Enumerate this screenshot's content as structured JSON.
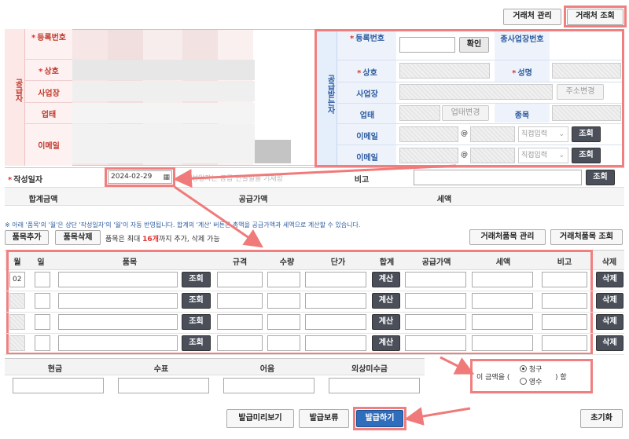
{
  "top_buttons": {
    "client_manage": "거래처 관리",
    "client_search": "거래처 조회"
  },
  "supplier": {
    "side_label": "공급자",
    "fields": [
      "등록번호",
      "상호",
      "사업장",
      "업태",
      "이메일"
    ]
  },
  "receiver": {
    "side_label": "공급받는자",
    "reg_no": "등록번호",
    "confirm": "확인",
    "sub_reg_no": "종사업장번호",
    "name": "상호",
    "ceo": "성명",
    "address": "사업장",
    "address_change": "주소변경",
    "business_type": "업태",
    "business_type_change": "업태변경",
    "item": "종목",
    "email": "이메일",
    "at": "@",
    "direct_input": "직접입력",
    "lookup": "조회"
  },
  "issue_date": {
    "label": "작성일자",
    "value": "2024-02-29",
    "note_prefix": "※",
    "note": "작성일자는 공급 연월일을 기재함",
    "memo_label": "비고",
    "lookup": "조회"
  },
  "totals_header": {
    "total": "합계금액",
    "supply": "공급가액",
    "tax": "세액"
  },
  "notice": "※ 아래 '품목'의 '월'은 상단 '작성일자'의 '월'이 자동 반영됩니다. 합계의 '계산' 버튼은 총액을 공급가액과 세액으로 계산할 수 있습니다.",
  "item_toolbar": {
    "add": "품목추가",
    "delete": "품목삭제",
    "limit_prefix": "품목은 최대 ",
    "limit_count": "16개",
    "limit_suffix": "까지 추가, 삭제 가능",
    "client_items_manage": "거래처품목 관리",
    "client_items_search": "거래처품목 조회"
  },
  "item_table": {
    "headers": [
      "월",
      "일",
      "품목",
      "규격",
      "수량",
      "단가",
      "합계",
      "공급가액",
      "세액",
      "비고",
      "삭제"
    ],
    "rows": [
      {
        "month": "02",
        "lookup": "조회",
        "calc": "계산",
        "delete": "삭제"
      },
      {
        "month": "",
        "lookup": "조회",
        "calc": "계산",
        "delete": "삭제"
      },
      {
        "month": "",
        "lookup": "조회",
        "calc": "계산",
        "delete": "삭제"
      },
      {
        "month": "",
        "lookup": "조회",
        "calc": "계산",
        "delete": "삭제"
      }
    ]
  },
  "payment": {
    "headers": [
      "현금",
      "수표",
      "어음",
      "외상미수금"
    ]
  },
  "amount_type": {
    "prefix": "이 금액을 (",
    "claim": "청구",
    "receipt": "영수",
    "suffix": ") 함",
    "selected": "청구"
  },
  "bottom_buttons": {
    "preview": "발급미리보기",
    "hold": "발급보류",
    "issue": "발급하기",
    "reset": "초기화"
  }
}
